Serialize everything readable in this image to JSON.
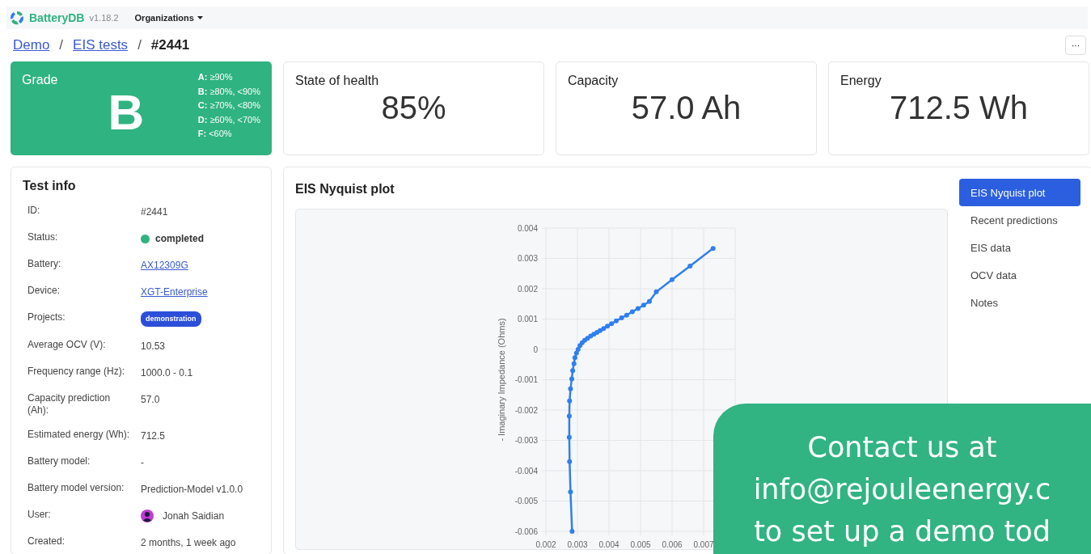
{
  "navbar": {
    "brand": "BatteryDB",
    "version": "v1.18.2",
    "menu": "Organizations"
  },
  "breadcrumb": [
    {
      "label": "Demo",
      "kind": "link"
    },
    {
      "label": "/",
      "kind": "separator"
    },
    {
      "label": "EIS tests",
      "kind": "link"
    },
    {
      "label": "/",
      "kind": "separator"
    },
    {
      "label": "#2441",
      "kind": "current"
    }
  ],
  "more_button": "···",
  "grade": {
    "title": "Grade",
    "value": "B",
    "scale": [
      {
        "letter": "A:",
        "range": "≥90%"
      },
      {
        "letter": "B:",
        "range": "≥80%, <90%"
      },
      {
        "letter": "C:",
        "range": "≥70%, <80%"
      },
      {
        "letter": "D:",
        "range": "≥60%, <70%"
      },
      {
        "letter": "F:",
        "range": "<60%"
      }
    ]
  },
  "metrics": [
    {
      "title": "State of health",
      "value": "85%"
    },
    {
      "title": "Capacity",
      "value": "57.0 Ah"
    },
    {
      "title": "Energy",
      "value": "712.5 Wh"
    }
  ],
  "test_info": {
    "title": "Test info",
    "rows": [
      {
        "label": "ID:",
        "value": "#2441",
        "kind": "text"
      },
      {
        "label": "Status:",
        "value": "completed",
        "kind": "status",
        "color": "#2fb380"
      },
      {
        "label": "Battery:",
        "value": "AX12309G",
        "kind": "link"
      },
      {
        "label": "Device:",
        "value": "XGT-Enterprise",
        "kind": "link"
      },
      {
        "label": "Projects:",
        "value": "demonstration",
        "kind": "badge"
      },
      {
        "label": "Average OCV (V):",
        "value": "10.53",
        "kind": "text"
      },
      {
        "label": "Frequency range (Hz):",
        "value": "1000.0 - 0.1",
        "kind": "text"
      },
      {
        "label": "Capacity prediction (Ah):",
        "value": "57.0",
        "kind": "text"
      },
      {
        "label": "Estimated energy (Wh):",
        "value": "712.5",
        "kind": "text"
      },
      {
        "label": "Battery model:",
        "value": "-",
        "kind": "text"
      },
      {
        "label": "Battery model version:",
        "value": "Prediction-Model v1.0.0",
        "kind": "text"
      },
      {
        "label": "User:",
        "value": "Jonah Saidian",
        "kind": "user"
      },
      {
        "label": "Created:",
        "value": "2 months, 1 week ago",
        "kind": "text"
      }
    ]
  },
  "plot": {
    "title": "EIS Nyquist plot",
    "chart_data": {
      "type": "line",
      "grid": true,
      "ylabel": "- Imaginary Impedance (Ohms)",
      "xlim": [
        0.002,
        0.008
      ],
      "ylim": [
        -0.006,
        0.004
      ],
      "xticks": [
        0.002,
        0.003,
        0.004,
        0.005,
        0.006,
        0.007
      ],
      "yticks": [
        0.004,
        0.003,
        0.002,
        0.001,
        0,
        -0.001,
        -0.002,
        -0.003,
        -0.004,
        -0.005,
        -0.006
      ],
      "x": [
        0.00283,
        0.00278,
        0.00275,
        0.00274,
        0.00274,
        0.00275,
        0.00278,
        0.00282,
        0.00285,
        0.00289,
        0.00292,
        0.00297,
        0.00302,
        0.00308,
        0.00315,
        0.00323,
        0.00332,
        0.00342,
        0.00352,
        0.00362,
        0.00372,
        0.00383,
        0.00395,
        0.00408,
        0.00423,
        0.0044,
        0.00456,
        0.00474,
        0.00492,
        0.0051,
        0.00528,
        0.0055,
        0.006,
        0.00657,
        0.0073
      ],
      "series": [
        {
          "color": "#2f7fee",
          "marker": true,
          "values": [
            -0.006,
            -0.0047,
            -0.0037,
            -0.0029,
            -0.0022,
            -0.0017,
            -0.0013,
            -0.00097,
            -0.0007,
            -0.00047,
            -0.00027,
            -0.00012,
            0,
            0.00013,
            0.00022,
            0.0003,
            0.00037,
            0.00044,
            0.0005,
            0.00056,
            0.00062,
            0.00069,
            0.00077,
            0.00085,
            0.00094,
            0.00104,
            0.00113,
            0.00124,
            0.00135,
            0.00146,
            0.00158,
            0.0019,
            0.0023,
            0.00275,
            0.00333
          ]
        }
      ]
    }
  },
  "side_tabs": [
    {
      "label": "EIS Nyquist plot",
      "selected": true
    },
    {
      "label": "Recent predictions",
      "selected": false
    },
    {
      "label": "EIS data",
      "selected": false
    },
    {
      "label": "OCV data",
      "selected": false
    },
    {
      "label": "Notes",
      "selected": false
    }
  ],
  "banner": [
    "Contact us at",
    "info@rejouleenergy.c",
    "to set up a demo tod"
  ]
}
